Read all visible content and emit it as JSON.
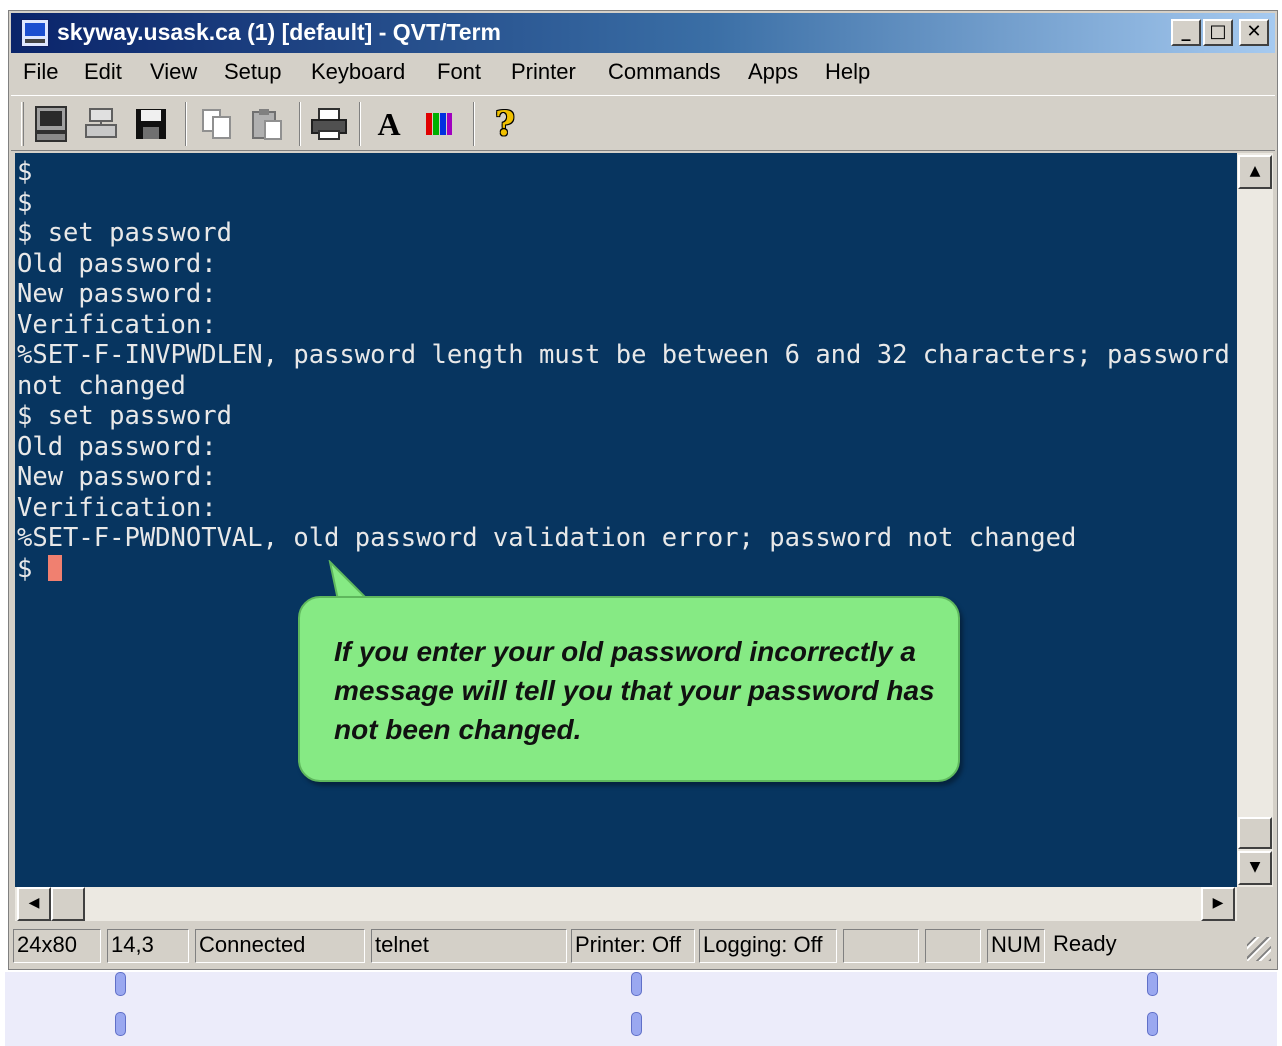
{
  "window": {
    "title": "skyway.usask.ca (1) [default] - QVT/Term",
    "controls": {
      "minimize": "_",
      "maximize": "□",
      "close": "✕"
    }
  },
  "menu": [
    {
      "label": "File"
    },
    {
      "label": "Edit"
    },
    {
      "label": "View"
    },
    {
      "label": "Setup"
    },
    {
      "label": "Keyboard"
    },
    {
      "label": "Font"
    },
    {
      "label": "Printer"
    },
    {
      "label": "Commands"
    },
    {
      "label": "Apps"
    },
    {
      "label": "Help"
    }
  ],
  "toolbar": {
    "buttons": [
      {
        "icon": "terminal-icon"
      },
      {
        "icon": "network-icon"
      },
      {
        "icon": "save-disk-icon"
      },
      {
        "icon": "copy-icon"
      },
      {
        "icon": "paste-icon"
      },
      {
        "icon": "printer-icon"
      },
      {
        "icon": "font-icon",
        "glyph": "A"
      },
      {
        "icon": "color-bars-icon"
      },
      {
        "icon": "help-icon",
        "glyph": "?"
      }
    ]
  },
  "terminal": {
    "lines": [
      "$",
      "$",
      "$ set password",
      "Old password:",
      "New password:",
      "Verification:",
      "%SET-F-INVPWDLEN, password length must be between 6 and 32 characters; password",
      "not changed",
      "$ set password",
      "Old password:",
      "New password:",
      "Verification:",
      "%SET-F-PWDNOTVAL, old password validation error; password not changed"
    ],
    "prompt": "$ ",
    "colors": {
      "background": "#073560",
      "text": "#e8e8e8",
      "cursor": "#f08070"
    }
  },
  "callout": {
    "text": "If you enter your old password incorrectly a message will tell you that your password has not been changed.",
    "color": "#86ea84"
  },
  "scrollbars": {
    "up": "▲",
    "down": "▼",
    "left": "◀",
    "right": "▶"
  },
  "status": {
    "size": "24x80",
    "cursor_pos": "14,3",
    "connection": "Connected",
    "protocol": "telnet",
    "printer": "Printer: Off",
    "logging": "Logging: Off",
    "blank1": "",
    "blank2": "",
    "num": "NUM",
    "ready": "Ready"
  }
}
